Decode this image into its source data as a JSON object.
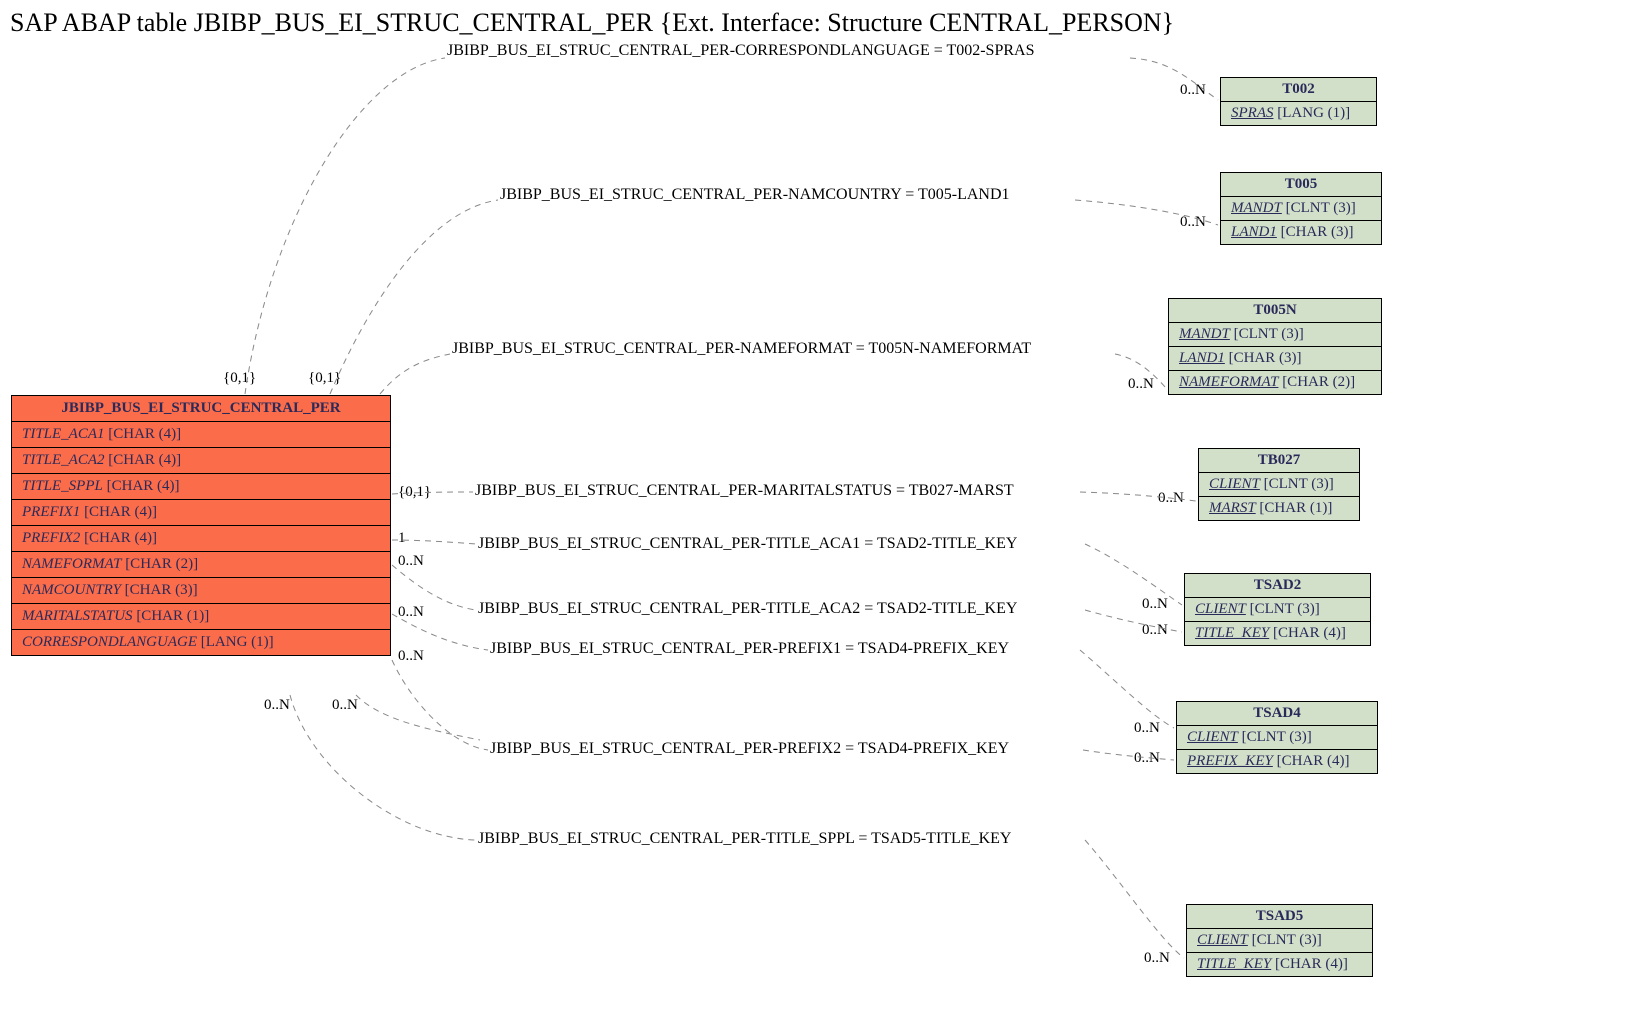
{
  "title": "SAP ABAP table JBIBP_BUS_EI_STRUC_CENTRAL_PER {Ext. Interface: Structure CENTRAL_PERSON}",
  "main": {
    "name": "JBIBP_BUS_EI_STRUC_CENTRAL_PER",
    "fields": [
      {
        "f": "TITLE_ACA1",
        "t": "[CHAR (4)]"
      },
      {
        "f": "TITLE_ACA2",
        "t": "[CHAR (4)]"
      },
      {
        "f": "TITLE_SPPL",
        "t": "[CHAR (4)]"
      },
      {
        "f": "PREFIX1",
        "t": "[CHAR (4)]"
      },
      {
        "f": "PREFIX2",
        "t": "[CHAR (4)]"
      },
      {
        "f": "NAMEFORMAT",
        "t": "[CHAR (2)]"
      },
      {
        "f": "NAMCOUNTRY",
        "t": "[CHAR (3)]"
      },
      {
        "f": "MARITALSTATUS",
        "t": "[CHAR (1)]"
      },
      {
        "f": "CORRESPONDLANGUAGE",
        "t": "[LANG (1)]"
      }
    ]
  },
  "refs": {
    "t002": {
      "name": "T002",
      "fields": [
        {
          "f": "SPRAS",
          "t": "[LANG (1)]"
        }
      ]
    },
    "t005": {
      "name": "T005",
      "fields": [
        {
          "f": "MANDT",
          "t": "[CLNT (3)]"
        },
        {
          "f": "LAND1",
          "t": "[CHAR (3)]"
        }
      ]
    },
    "t005n": {
      "name": "T005N",
      "fields": [
        {
          "f": "MANDT",
          "t": "[CLNT (3)]"
        },
        {
          "f": "LAND1",
          "t": "[CHAR (3)]"
        },
        {
          "f": "NAMEFORMAT",
          "t": "[CHAR (2)]"
        }
      ]
    },
    "tb027": {
      "name": "TB027",
      "fields": [
        {
          "f": "CLIENT",
          "t": "[CLNT (3)]"
        },
        {
          "f": "MARST",
          "t": "[CHAR (1)]"
        }
      ]
    },
    "tsad2": {
      "name": "TSAD2",
      "fields": [
        {
          "f": "CLIENT",
          "t": "[CLNT (3)]"
        },
        {
          "f": "TITLE_KEY",
          "t": "[CHAR (4)]"
        }
      ]
    },
    "tsad4": {
      "name": "TSAD4",
      "fields": [
        {
          "f": "CLIENT",
          "t": "[CLNT (3)]"
        },
        {
          "f": "PREFIX_KEY",
          "t": "[CHAR (4)]"
        }
      ]
    },
    "tsad5": {
      "name": "TSAD5",
      "fields": [
        {
          "f": "CLIENT",
          "t": "[CLNT (3)]"
        },
        {
          "f": "TITLE_KEY",
          "t": "[CHAR (4)]"
        }
      ]
    }
  },
  "rels": {
    "r1": "JBIBP_BUS_EI_STRUC_CENTRAL_PER-CORRESPONDLANGUAGE = T002-SPRAS",
    "r2": "JBIBP_BUS_EI_STRUC_CENTRAL_PER-NAMCOUNTRY = T005-LAND1",
    "r3": "JBIBP_BUS_EI_STRUC_CENTRAL_PER-NAMEFORMAT = T005N-NAMEFORMAT",
    "r4": "JBIBP_BUS_EI_STRUC_CENTRAL_PER-MARITALSTATUS = TB027-MARST",
    "r5": "JBIBP_BUS_EI_STRUC_CENTRAL_PER-TITLE_ACA1 = TSAD2-TITLE_KEY",
    "r6": "JBIBP_BUS_EI_STRUC_CENTRAL_PER-TITLE_ACA2 = TSAD2-TITLE_KEY",
    "r7": "JBIBP_BUS_EI_STRUC_CENTRAL_PER-PREFIX1 = TSAD4-PREFIX_KEY",
    "r8": "JBIBP_BUS_EI_STRUC_CENTRAL_PER-PREFIX2 = TSAD4-PREFIX_KEY",
    "r9": "JBIBP_BUS_EI_STRUC_CENTRAL_PER-TITLE_SPPL = TSAD5-TITLE_KEY"
  },
  "cards": {
    "c01": "{0,1}",
    "c1": "1",
    "c0n": "0..N"
  }
}
